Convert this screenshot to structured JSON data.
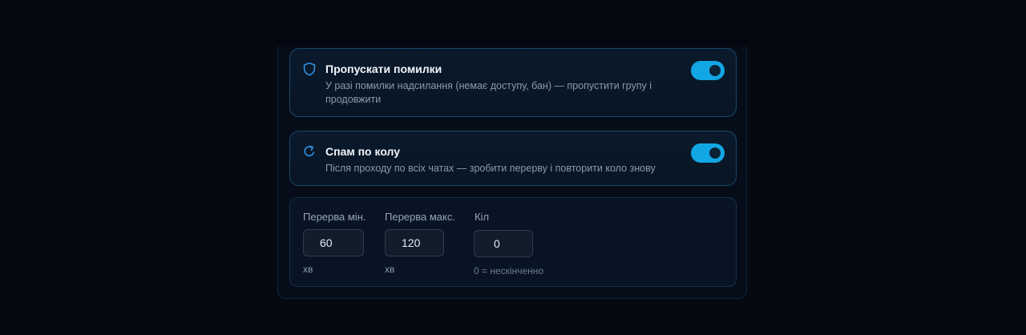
{
  "skip_errors": {
    "title": "Пропускати помилки",
    "description": "У разі помилки надсилання (немає доступу, бан) — пропустити групу і продовжити",
    "icon": "shield-icon",
    "enabled": true
  },
  "spam_loop": {
    "title": "Спам по колу",
    "description": "Після проходу по всіх чатах — зробити перерву і повторити коло знову",
    "icon": "refresh-icon",
    "enabled": true
  },
  "loop_settings": {
    "pause_min": {
      "label": "Перерва мін.",
      "value": "60",
      "unit": "хв"
    },
    "pause_max": {
      "label": "Перерва макс.",
      "value": "120",
      "unit": "хв"
    },
    "count": {
      "label": "Кіл",
      "value": "0",
      "hint": "0 = нескінченно"
    }
  },
  "colors": {
    "accent": "#12a7e4",
    "icon": "#2f8fe0",
    "background": "#050810"
  }
}
